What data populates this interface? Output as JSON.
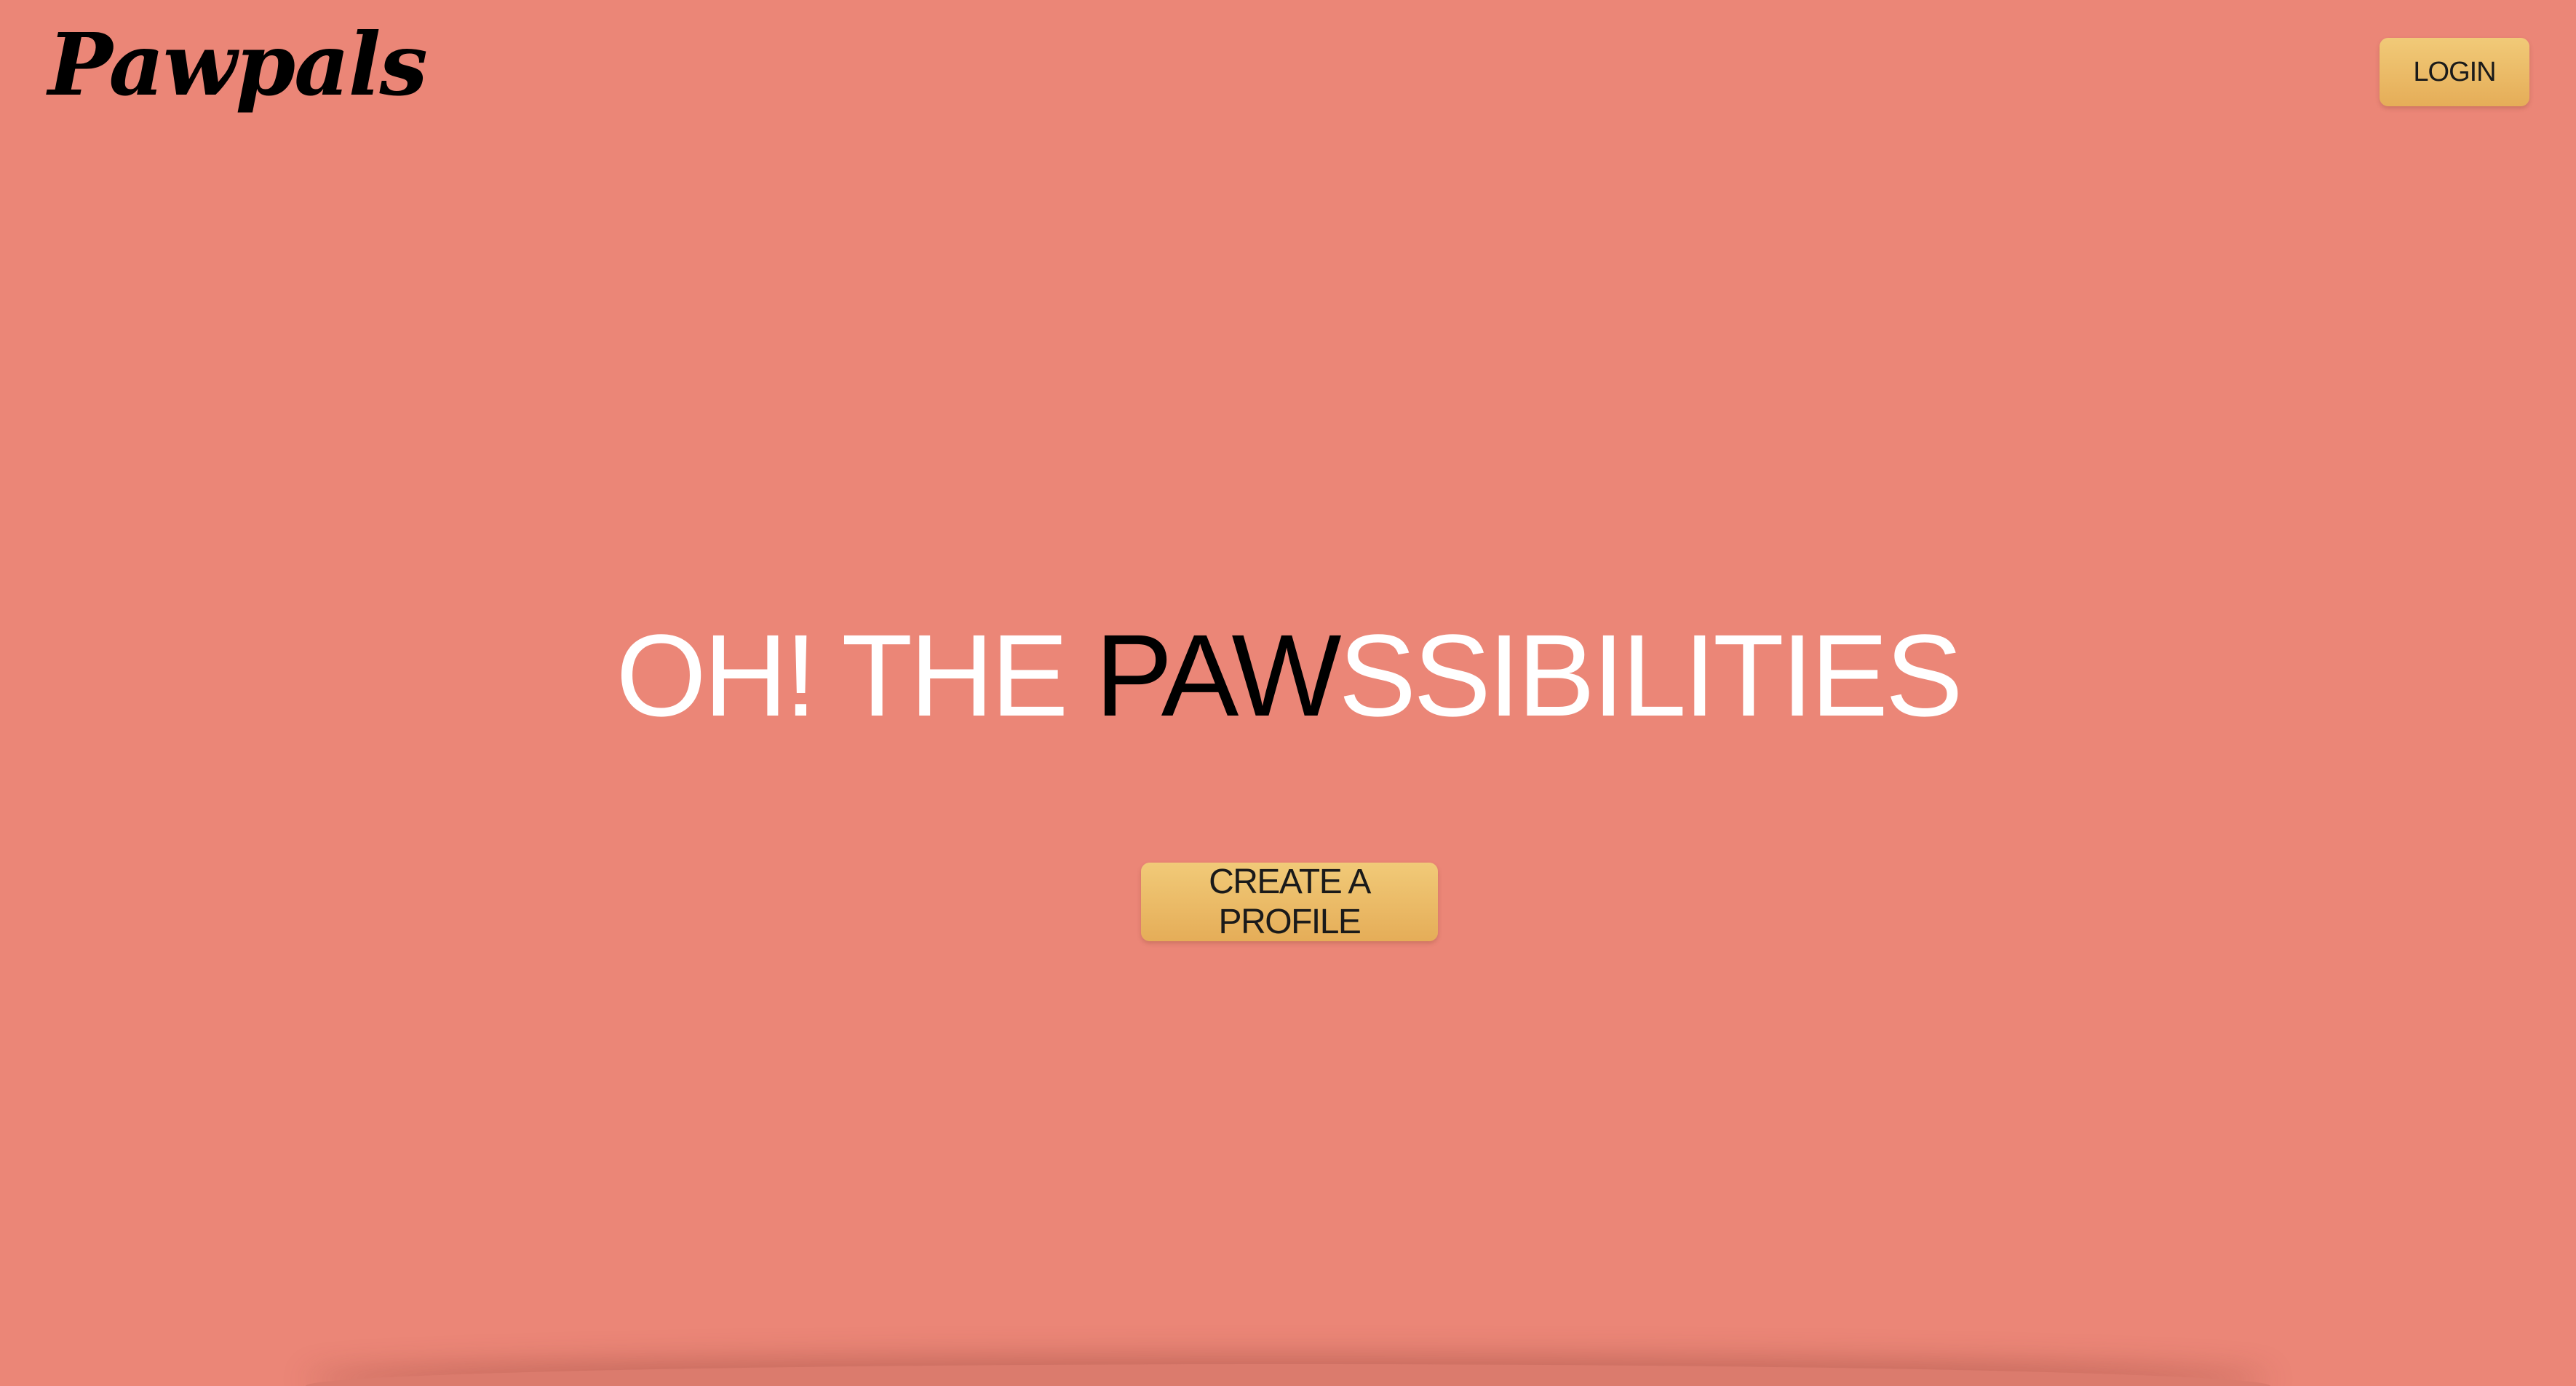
{
  "header": {
    "logo_text": "Pawpals",
    "login_label": "LOGIN"
  },
  "hero": {
    "headline_prefix": "OH! THE ",
    "headline_highlight": "PAW",
    "headline_suffix": "SSIBILITIES",
    "cta_label": "CREATE A PROFILE"
  },
  "colors": {
    "background": "#eb8677",
    "button": "#ebbb68",
    "headline_light": "#ffffff",
    "headline_highlight": "#000000"
  }
}
